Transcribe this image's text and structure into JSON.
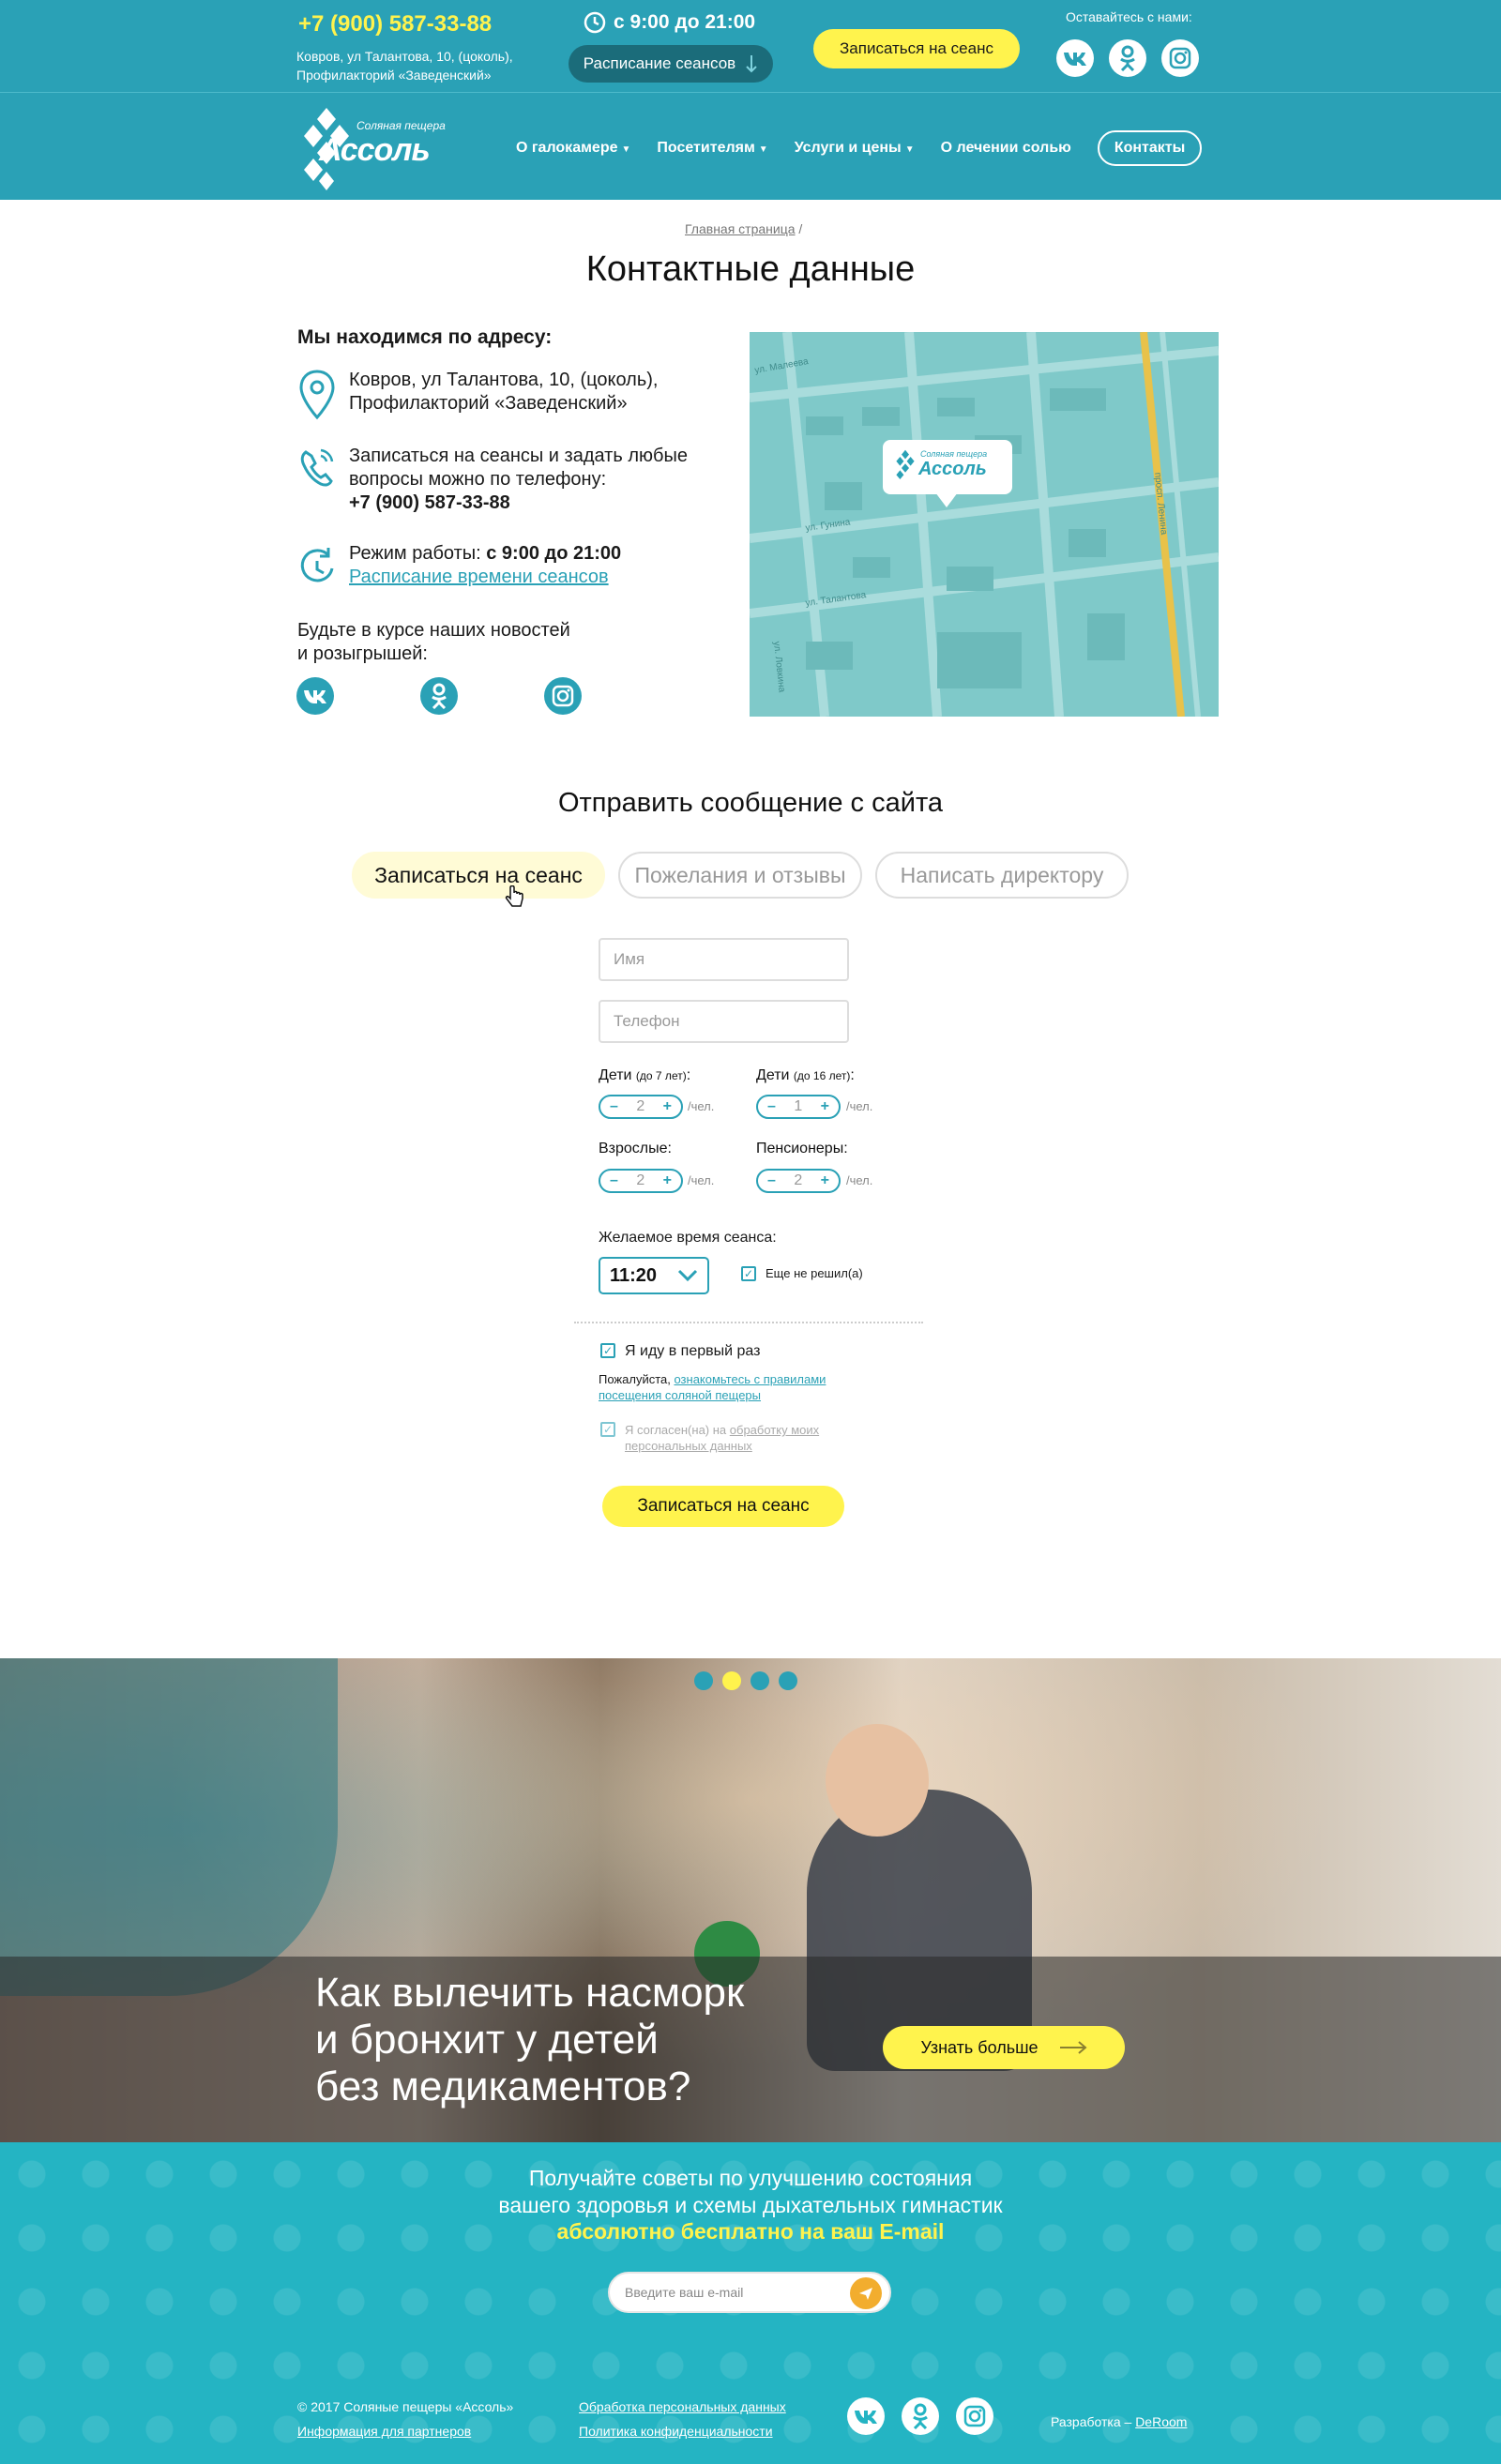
{
  "colors": {
    "brand_teal": "#2aa1b6",
    "accent_yellow": "#fff34d",
    "footer_teal": "#24b4c3",
    "send_orange": "#f2ad2e"
  },
  "topbar": {
    "phone": "+7 (900) 587-33-88",
    "address_line1": "Ковров, ул Талантова, 10, (цоколь),",
    "address_line2": "Профилакторий «Заведенский»",
    "hours": "с 9:00 до 21:00",
    "schedule_button": "Расписание сеансов",
    "book_button": "Записаться на сеанс",
    "stay_label": "Оставайтесь с нами:",
    "socials": [
      "vk-icon",
      "odnoklassniki-icon",
      "instagram-icon"
    ]
  },
  "nav": {
    "logo_subtitle": "Соляная пещера",
    "logo_name": "Ассоль",
    "items": [
      {
        "label": "О галокамере",
        "has_caret": true
      },
      {
        "label": "Посетителям",
        "has_caret": true
      },
      {
        "label": "Услуги и цены",
        "has_caret": true
      },
      {
        "label": "О лечении солью",
        "has_caret": false
      }
    ],
    "contacts_label": "Контакты"
  },
  "contacts": {
    "breadcrumb_home": "Главная страница",
    "breadcrumb_sep": " /",
    "title": "Контактные данные",
    "address_heading": "Мы находимся по адресу:",
    "address_line1": "Ковров, ул Талантова, 10, (цоколь),",
    "address_line2": "Профилакторий «Заведенский»",
    "phone_line1": "Записаться на сеансы и задать любые",
    "phone_line2": "вопросы можно по телефону:",
    "phone": "+7 (900) 587-33-88",
    "hours_prefix": "Режим работы: ",
    "hours": "с 9:00 до 21:00",
    "schedule_link": "Расписание времени сеансов",
    "news_line1": "Будьте в курсе наших новостей",
    "news_line2": "и розыгрышей:",
    "map_streets": [
      "ул. Малеева",
      "ул. Гунина",
      "ул. Талантова",
      "просп. Ленина",
      "ул. Ловкина"
    ],
    "map_pin_subtitle": "Соляная пещера",
    "map_pin_name": "Ассоль"
  },
  "form": {
    "title": "Отправить сообщение с сайта",
    "tabs": [
      "Записаться на сеанс",
      "Пожелания и отзывы",
      "Написать директору"
    ],
    "name_placeholder": "Имя",
    "phone_placeholder": "Телефон",
    "counters": [
      {
        "label": "Дети",
        "note": "(до 7 лет)",
        "suffix": ":",
        "value": "2"
      },
      {
        "label": "Дети",
        "note": "(до 16 лет)",
        "suffix": ":",
        "value": "1"
      },
      {
        "label": "Взрослые:",
        "note": "",
        "suffix": "",
        "value": "2"
      },
      {
        "label": "Пенсионеры:",
        "note": "",
        "suffix": "",
        "value": "2"
      }
    ],
    "per_unit": "/чел.",
    "minus": "–",
    "plus": "+",
    "time_label": "Желаемое время сеанса:",
    "time_value": "11:20",
    "undecided_label": "Еще не решил(а)",
    "first_time_label": "Я иду в первый раз",
    "rules_prefix": "Пожалуйста, ",
    "rules_link_1": "ознакомьтесь с правилами",
    "rules_link_2": "посещения соляной пещеры",
    "consent_prefix": "Я согласен(на) на ",
    "consent_link_1": "обработку моих",
    "consent_link_2": "персональных данных",
    "submit": "Записаться на сеанс"
  },
  "banner": {
    "slides": 4,
    "active_slide": 1,
    "title_line1": "Как вылечить насморк",
    "title_line2": "и бронхит у детей",
    "title_line3": "без медикаментов?",
    "button": "Узнать больше"
  },
  "newsletter": {
    "line1": "Получайте советы по улучшению состояния",
    "line2": "вашего здоровья и схемы дыхательных гимнастик",
    "accent": "абсолютно бесплатно на ваш E-mail",
    "email_placeholder": "Введите ваш e-mail"
  },
  "footer": {
    "copyright": "© 2017 Соляные пещеры «Ассоль»",
    "partners": "Информация для партнеров",
    "personal_data": "Обработка персональных данных",
    "privacy": "Политика конфиденциальности",
    "dev_prefix": "Разработка – ",
    "dev_link": "DeRoom"
  }
}
